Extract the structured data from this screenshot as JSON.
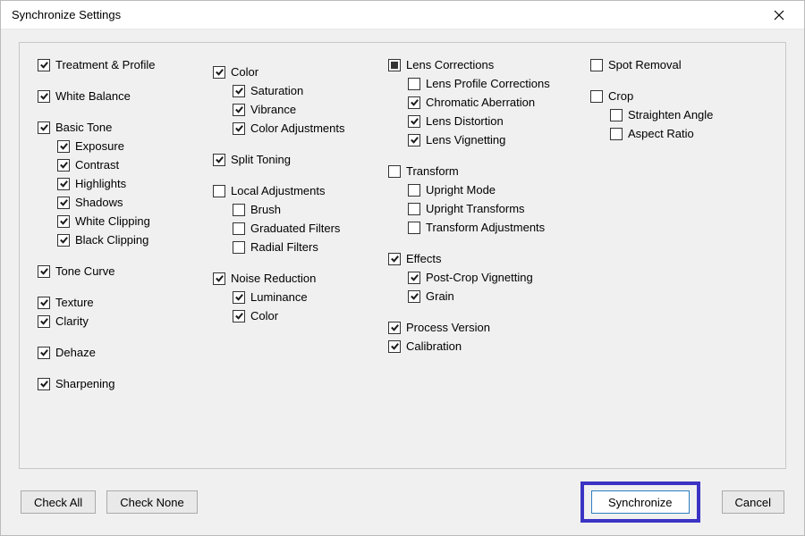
{
  "titlebar": {
    "title": "Synchronize Settings"
  },
  "col1": {
    "treatment": "Treatment & Profile",
    "whitebalance": "White Balance",
    "basictone": "Basic Tone",
    "exposure": "Exposure",
    "contrast": "Contrast",
    "highlights": "Highlights",
    "shadows": "Shadows",
    "whiteclip": "White Clipping",
    "blackclip": "Black Clipping",
    "tonecurve": "Tone Curve",
    "texture": "Texture",
    "clarity": "Clarity",
    "dehaze": "Dehaze",
    "sharpening": "Sharpening"
  },
  "col2": {
    "color": "Color",
    "saturation": "Saturation",
    "vibrance": "Vibrance",
    "coloradj": "Color Adjustments",
    "splittoning": "Split Toning",
    "localadj": "Local Adjustments",
    "brush": "Brush",
    "gradfilters": "Graduated Filters",
    "radialfilters": "Radial Filters",
    "noisereduction": "Noise Reduction",
    "luminance": "Luminance",
    "nr_color": "Color"
  },
  "col3": {
    "lenscorr": "Lens Corrections",
    "lensprofile": "Lens Profile Corrections",
    "chromab": "Chromatic Aberration",
    "lensdist": "Lens Distortion",
    "lensvig": "Lens Vignetting",
    "transform": "Transform",
    "uprightmode": "Upright Mode",
    "uprighttrans": "Upright Transforms",
    "transadj": "Transform Adjustments",
    "effects": "Effects",
    "postcropvig": "Post-Crop Vignetting",
    "grain": "Grain",
    "procver": "Process Version",
    "calibration": "Calibration"
  },
  "col4": {
    "spotremoval": "Spot Removal",
    "crop": "Crop",
    "straighten": "Straighten Angle",
    "aspect": "Aspect Ratio"
  },
  "buttons": {
    "checkall": "Check All",
    "checknone": "Check None",
    "synchronize": "Synchronize",
    "cancel": "Cancel"
  }
}
